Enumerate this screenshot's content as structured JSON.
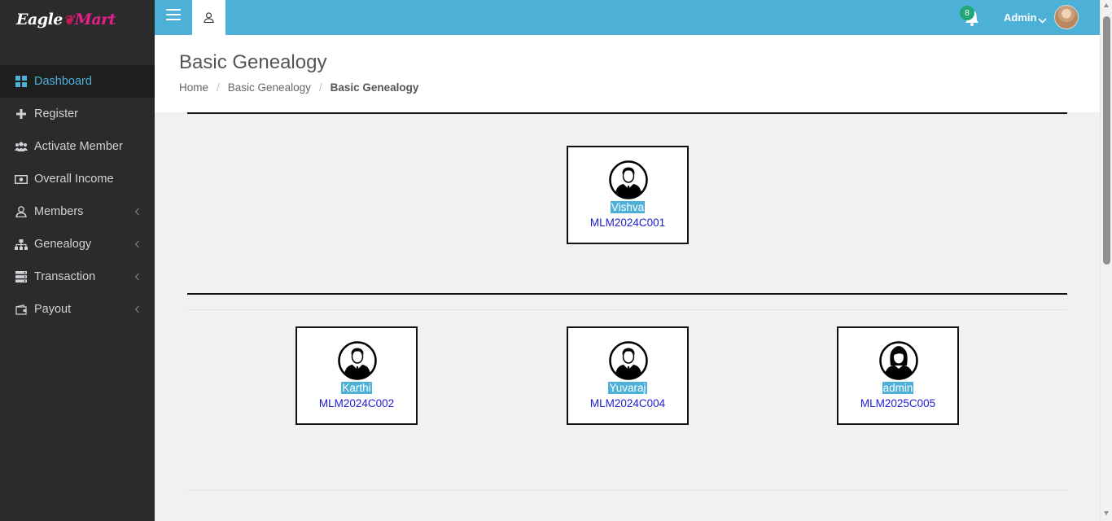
{
  "brand": {
    "logo_part1": "Eagle",
    "logo_part2": "Mart"
  },
  "sidebar": {
    "items": [
      {
        "label": "Dashboard",
        "icon": "dashboard-icon",
        "active": true
      },
      {
        "label": "Register",
        "icon": "plus-icon"
      },
      {
        "label": "Activate Member",
        "icon": "users-icon"
      },
      {
        "label": "Overall Income",
        "icon": "money-icon"
      },
      {
        "label": "Members",
        "icon": "user-icon",
        "has_submenu": true
      },
      {
        "label": "Genealogy",
        "icon": "sitemap-icon",
        "has_submenu": true
      },
      {
        "label": "Transaction",
        "icon": "server-icon",
        "has_submenu": true
      },
      {
        "label": "Payout",
        "icon": "wallet-icon",
        "has_submenu": true
      }
    ]
  },
  "topbar": {
    "notification_count": "8",
    "user_name": "Admin"
  },
  "header": {
    "title": "Basic Genealogy",
    "breadcrumb": [
      "Home",
      "Basic Genealogy",
      "Basic Genealogy"
    ]
  },
  "tree": {
    "root": {
      "name": "Vishva",
      "code": "MLM2024C001",
      "avatar": "male-avatar-icon"
    },
    "children": [
      {
        "name": "Karthi",
        "code": "MLM2024C002",
        "avatar": "male-avatar-icon"
      },
      {
        "name": "Yuvaraj",
        "code": "MLM2024C004",
        "avatar": "male-avatar-icon"
      },
      {
        "name": "admin",
        "code": "MLM2025C005",
        "avatar": "female-avatar-icon"
      }
    ]
  },
  "colors": {
    "accent": "#4db1d7",
    "sidebar_bg": "#2b2b2b",
    "badge": "#22a677",
    "link": "#1c1cd6"
  }
}
